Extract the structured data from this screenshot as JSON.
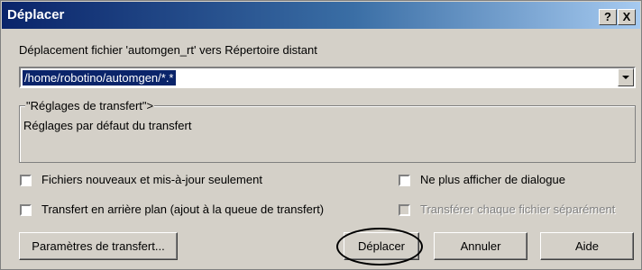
{
  "dialog": {
    "title": "Déplacer",
    "help_label": "?",
    "close_label": "X",
    "description": "Déplacement fichier 'automgen_rt' vers Répertoire distant",
    "path_value": "/home/robotino/automgen/*.*",
    "group_legend": "\"Réglages de transfert\">",
    "group_text": "Réglages par défaut du transfert"
  },
  "options": {
    "new_updated_only": {
      "label": "Fichiers nouveaux et mis-à-jour seulement",
      "checked": false
    },
    "no_dialog": {
      "label": "Ne plus afficher de dialogue",
      "checked": false
    },
    "background_transfer": {
      "label": "Transfert en arrière plan (ajout à la queue de transfert)",
      "checked": false
    },
    "separate_transfer": {
      "label": "Transférer chaque fichier séparément",
      "checked": false,
      "enabled": false
    }
  },
  "buttons": {
    "transfer_params": "Paramètres de transfert...",
    "move": "Déplacer",
    "cancel": "Annuler",
    "help": "Aide"
  },
  "colors": {
    "title_bar_start": "#0a246a",
    "title_bar_end": "#a6caf0",
    "dialog_bg": "#d4d0c8",
    "selection_bg": "#0a246a"
  }
}
